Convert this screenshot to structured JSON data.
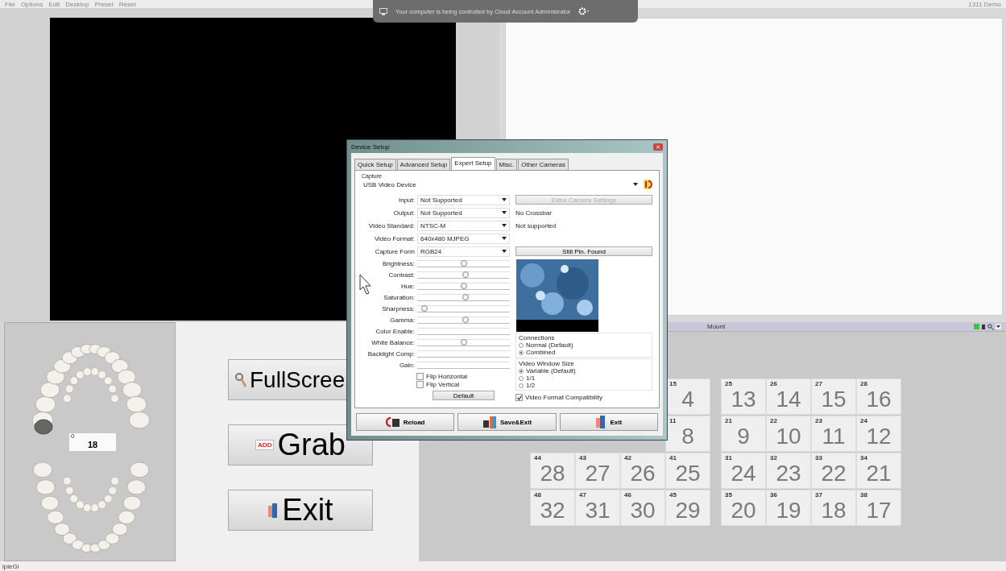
{
  "menu": [
    "File",
    "Options",
    "Edit",
    "Desktop",
    "Preset",
    "Reset"
  ],
  "app_title": "1311 Demo",
  "remote_banner": {
    "text": "Your computer is being controlled by Cloud Account Administrator"
  },
  "tooth_chart": {
    "field_label": "0",
    "field_value": "18"
  },
  "actions": [
    {
      "label": "FullScree",
      "kind": "search"
    },
    {
      "label": "Grab",
      "kind": "add",
      "icon_label": "ADD"
    },
    {
      "label": "Exit",
      "kind": "exit"
    }
  ],
  "mount_bar": {
    "title": "Mount"
  },
  "tooth_grid": {
    "rows": [
      [
        {
          "code": "15",
          "number": "4"
        },
        {
          "code": "25",
          "number": "13"
        },
        {
          "code": "26",
          "number": "14"
        },
        {
          "code": "27",
          "number": "15"
        },
        {
          "code": "28",
          "number": "16"
        }
      ],
      [
        {
          "code": "11",
          "number": "8"
        },
        {
          "code": "21",
          "number": "9"
        },
        {
          "code": "22",
          "number": "10"
        },
        {
          "code": "23",
          "number": "11"
        },
        {
          "code": "24",
          "number": "12"
        }
      ],
      [
        {
          "code": "44",
          "number": "28"
        },
        {
          "code": "43",
          "number": "27"
        },
        {
          "code": "42",
          "number": "26"
        },
        {
          "code": "41",
          "number": "25"
        },
        {
          "code": "31",
          "number": "24"
        },
        {
          "code": "32",
          "number": "23"
        },
        {
          "code": "33",
          "number": "22"
        },
        {
          "code": "34",
          "number": "21"
        }
      ],
      [
        {
          "code": "48",
          "number": "32"
        },
        {
          "code": "47",
          "number": "31"
        },
        {
          "code": "46",
          "number": "30"
        },
        {
          "code": "45",
          "number": "29"
        },
        {
          "code": "35",
          "number": "20"
        },
        {
          "code": "36",
          "number": "19"
        },
        {
          "code": "37",
          "number": "18"
        },
        {
          "code": "38",
          "number": "17"
        }
      ]
    ]
  },
  "status_bar": {
    "text": "ipleGi"
  },
  "dialog": {
    "title": "Device Setup",
    "tabs": [
      {
        "label": "Quick Setup",
        "selected": false
      },
      {
        "label": "Advanced Setup",
        "selected": false
      },
      {
        "label": "Expert Setup",
        "selected": true
      },
      {
        "label": "Misc.",
        "selected": false
      },
      {
        "label": "Other Cameras",
        "selected": false
      }
    ],
    "capture_label": "Capture",
    "device": "USB Video Device",
    "selects": [
      {
        "label": "Input:",
        "value": "Not Supported"
      },
      {
        "label": "Output:",
        "value": "Not Supported"
      },
      {
        "label": "Video Standard:",
        "value": "NTSC-M"
      },
      {
        "label": "Video Format:",
        "value": "640x480 MJPEG"
      },
      {
        "label": "Capture Form",
        "value": "RGB24"
      }
    ],
    "sliders": [
      {
        "label": "Brightness:",
        "level": 0.5
      },
      {
        "label": "Contrast:",
        "level": 0.52
      },
      {
        "label": "Hue:",
        "level": 0.5
      },
      {
        "label": "Saturation:",
        "level": 0.52
      },
      {
        "label": "Sharpness:",
        "level": 0.08
      },
      {
        "label": "Gamma:",
        "level": 0.52
      },
      {
        "label": "Color Enable:"
      },
      {
        "label": "White Balance:",
        "level": 0.5
      },
      {
        "label": "Backlight Comp:"
      },
      {
        "label": "Gain:"
      }
    ],
    "flips": [
      {
        "label": "Flip Horizontal",
        "checked": false
      },
      {
        "label": "Flip Vertical",
        "checked": false
      }
    ],
    "default_button": "Default",
    "extra_button": {
      "label": "Extra Camera Settings",
      "disabled": true
    },
    "crossbar": "No Crossbar",
    "standard_note": "Not supported",
    "still_button": "Still Pin. Found",
    "connections": {
      "title": "Connections",
      "options": [
        {
          "label": "Normal (Default)",
          "selected": false
        },
        {
          "label": "Combined",
          "selected": true
        }
      ]
    },
    "window_size": {
      "title": "Video Window Size",
      "options": [
        {
          "label": "Variable (Default)",
          "selected": true
        },
        {
          "label": "1/1",
          "selected": false
        },
        {
          "label": "1/2",
          "selected": false
        }
      ]
    },
    "compat": {
      "label": "Video Format Compatibility",
      "checked": true
    },
    "buttons": [
      {
        "label": "Reload",
        "kind": "reload"
      },
      {
        "label": "Save&Exit",
        "kind": "save"
      },
      {
        "label": "Exit",
        "kind": "exit"
      }
    ]
  }
}
